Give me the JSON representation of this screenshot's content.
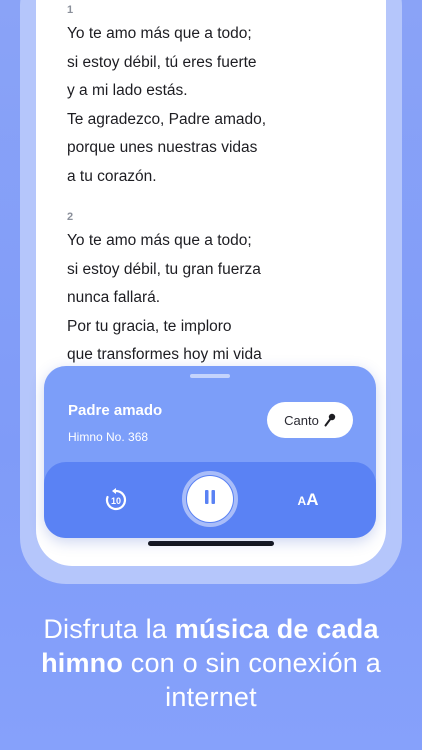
{
  "lyrics": {
    "verses": [
      {
        "number": "1",
        "lines": [
          "Yo te amo más que a todo;",
          "si estoy débil, tú eres fuerte",
          "y a mi lado estás.",
          "Te agradezco, Padre amado,",
          "porque unes nuestras vidas",
          "a tu corazón."
        ]
      },
      {
        "number": "2",
        "lines": [
          "Yo te amo más que a todo;",
          "si estoy débil, tu gran fuerza",
          "nunca fallará.",
          "Por tu gracia, te imploro",
          "que transformes hoy mi vida"
        ]
      }
    ]
  },
  "player": {
    "title": "Padre amado",
    "subtitle": "Himno No. 368",
    "canto_label": "Canto",
    "rewind_seconds": "10",
    "font_small": "A",
    "font_large": "A"
  },
  "promo": {
    "part1": "Disfruta la ",
    "part2": "música de cada himno",
    "part3": " con o sin conexión a internet"
  },
  "colors": {
    "background": "#8aa3f7",
    "player": "#7c9ef9",
    "controls": "#5a82f4",
    "accent": "#5a82f4"
  },
  "icons": {
    "rewind": "rewind-10-icon",
    "pause": "pause-icon",
    "mic": "microphone-icon",
    "font_size": "text-size-icon"
  }
}
